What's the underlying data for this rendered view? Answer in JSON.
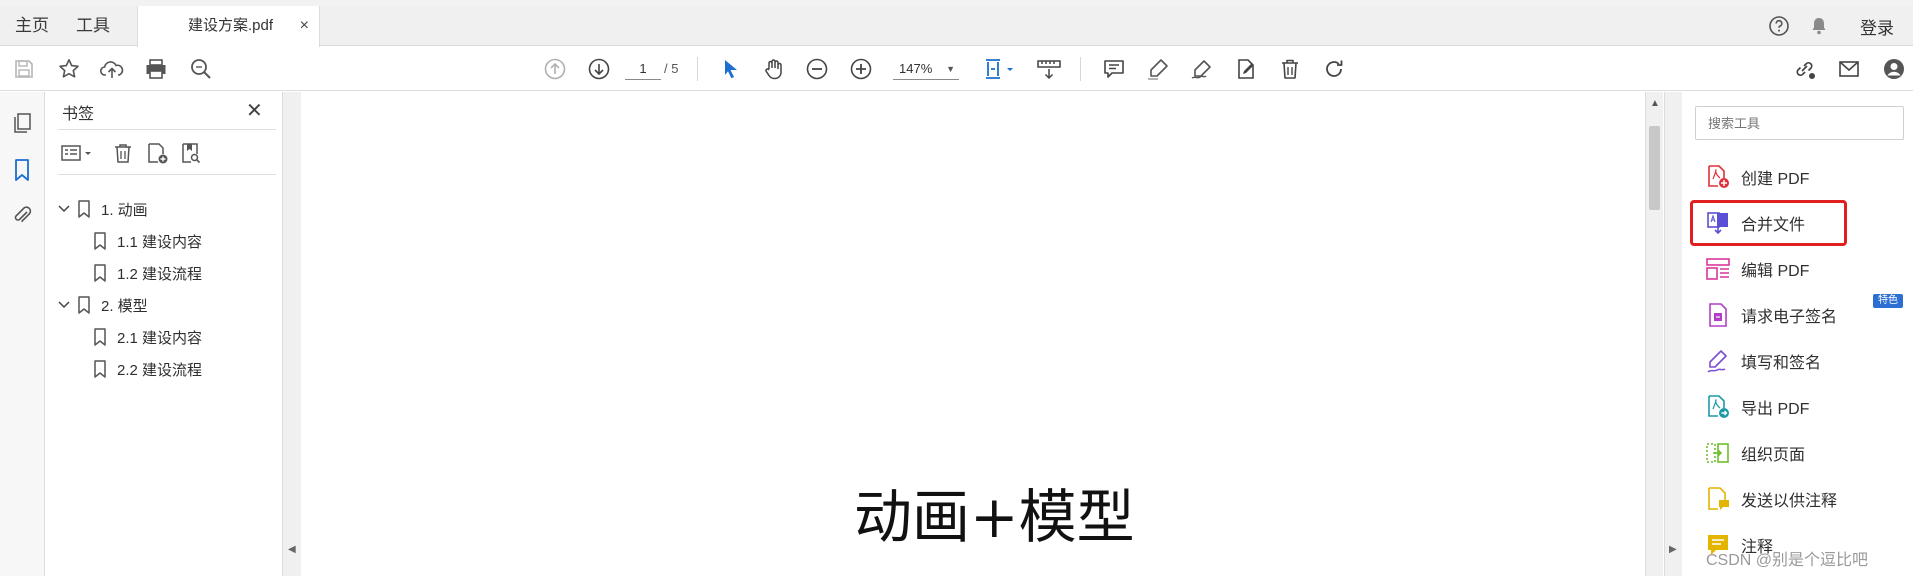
{
  "tabbar": {
    "home_label": "主页",
    "tools_label": "工具",
    "doc_tab_label": "建设方案.pdf",
    "doc_tab_close": "×",
    "login_label": "登录"
  },
  "toolbar": {
    "page_current": "1",
    "page_total": "/ 5",
    "zoom": "147%"
  },
  "bookmarks": {
    "title": "书签",
    "close": "✕",
    "items": [
      {
        "label": "1. 动画",
        "level": 1
      },
      {
        "label": "1.1  建设内容",
        "level": 2
      },
      {
        "label": "1.2  建设流程",
        "level": 2
      },
      {
        "label": "2. 模型",
        "level": 1
      },
      {
        "label": "2.1  建设内容",
        "level": 2
      },
      {
        "label": "2.2  建设流程",
        "level": 2
      }
    ]
  },
  "document": {
    "heading": "动画+模型"
  },
  "tools_pane": {
    "search_placeholder": "搜索工具",
    "badge": "特色",
    "items": [
      {
        "label": "创建 PDF",
        "icon": "create-pdf-icon",
        "color": "#e0303a"
      },
      {
        "label": "合并文件",
        "icon": "combine-files-icon",
        "color": "#5b4fd6"
      },
      {
        "label": "编辑 PDF",
        "icon": "edit-pdf-icon",
        "color": "#d8379a"
      },
      {
        "label": "请求电子签名",
        "icon": "request-signature-icon",
        "color": "#b23fc8"
      },
      {
        "label": "填写和签名",
        "icon": "fill-sign-icon",
        "color": "#7b4fd0"
      },
      {
        "label": "导出 PDF",
        "icon": "export-pdf-icon",
        "color": "#1e9aa6"
      },
      {
        "label": "组织页面",
        "icon": "organize-pages-icon",
        "color": "#6fbf2b"
      },
      {
        "label": "发送以供注释",
        "icon": "send-comment-icon",
        "color": "#e3b400"
      },
      {
        "label": "注释",
        "icon": "comment-icon",
        "color": "#e3b400"
      }
    ]
  },
  "watermark": "CSDN @别是个逗比吧",
  "colors": {
    "accent_blue": "#1a6fd1",
    "highlight_red": "#e02020"
  }
}
